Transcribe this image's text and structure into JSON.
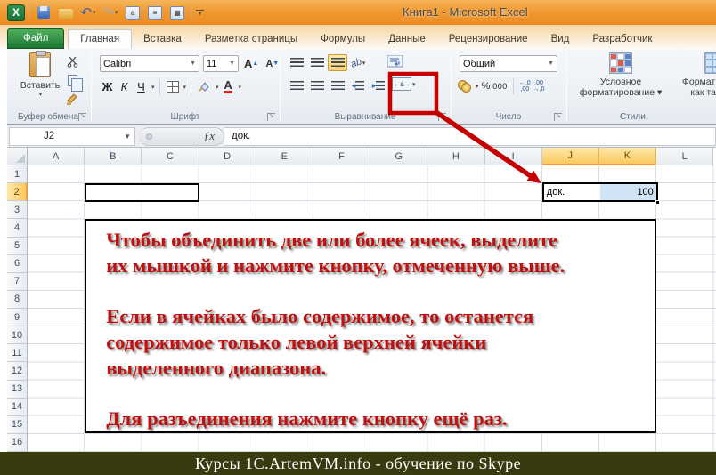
{
  "window": {
    "title": "Книга1 - Microsoft Excel"
  },
  "icons": {
    "excel_logo": "X",
    "undo": "↶",
    "redo": "↷",
    "dropdown": "▾",
    "table_a": "a",
    "form": "≡",
    "calc": "▦"
  },
  "tabs": [
    {
      "label": "Файл"
    },
    {
      "label": "Главная"
    },
    {
      "label": "Вставка"
    },
    {
      "label": "Разметка страницы"
    },
    {
      "label": "Формулы"
    },
    {
      "label": "Данные"
    },
    {
      "label": "Рецензирование"
    },
    {
      "label": "Вид"
    },
    {
      "label": "Разработчик"
    }
  ],
  "ribbon": {
    "clipboard": {
      "paste": "Вставить",
      "label": "Буфер обмена"
    },
    "font": {
      "family": "Calibri",
      "size": "11",
      "bold": "Ж",
      "italic": "К",
      "underline": "Ч",
      "grow": "A",
      "shrink": "A",
      "color_letter": "А",
      "label": "Шрифт"
    },
    "alignment": {
      "orientation": "ab",
      "merge_icon": "←a→",
      "label": "Выравнивание"
    },
    "number": {
      "format": "Общий",
      "percent": "%",
      "thousands": "000",
      "inc_decimal": "←,0\n,00",
      "dec_decimal": ",00\n→,0",
      "label": "Число"
    },
    "styles": {
      "conditional": "Условное\nформатирование ▾",
      "format_table": "Форматировать\nкак таблицу",
      "label": "Стили"
    }
  },
  "formula_bar": {
    "name_box": "J2",
    "fx": "ƒx",
    "content": "док."
  },
  "sheet": {
    "columns": [
      "A",
      "B",
      "C",
      "D",
      "E",
      "F",
      "G",
      "H",
      "I",
      "J",
      "K",
      "L"
    ],
    "highlight_columns": [
      "J",
      "K"
    ],
    "rows": [
      "1",
      "2",
      "3",
      "4",
      "5",
      "6",
      "7",
      "8",
      "9",
      "10",
      "11",
      "12",
      "13",
      "14",
      "15",
      "16"
    ],
    "highlight_rows": [
      "2"
    ],
    "cells": {
      "j2": "док.",
      "k2": "100"
    }
  },
  "annotation": {
    "color": "#c01111",
    "paragraphs": [
      "Чтобы объединить две или более ячеек, выделите\nих мышкой и нажмите кнопку, отмеченную выше.",
      "Если в ячейках было содержимое, то останется\nсодержимое только левой верхней ячейки\nвыделенного диапазона.",
      "Для разъединения нажмите кнопку ещё раз."
    ]
  },
  "footer": {
    "text": "Курсы 1С.ArtemVM.info - обучение по Skype"
  }
}
